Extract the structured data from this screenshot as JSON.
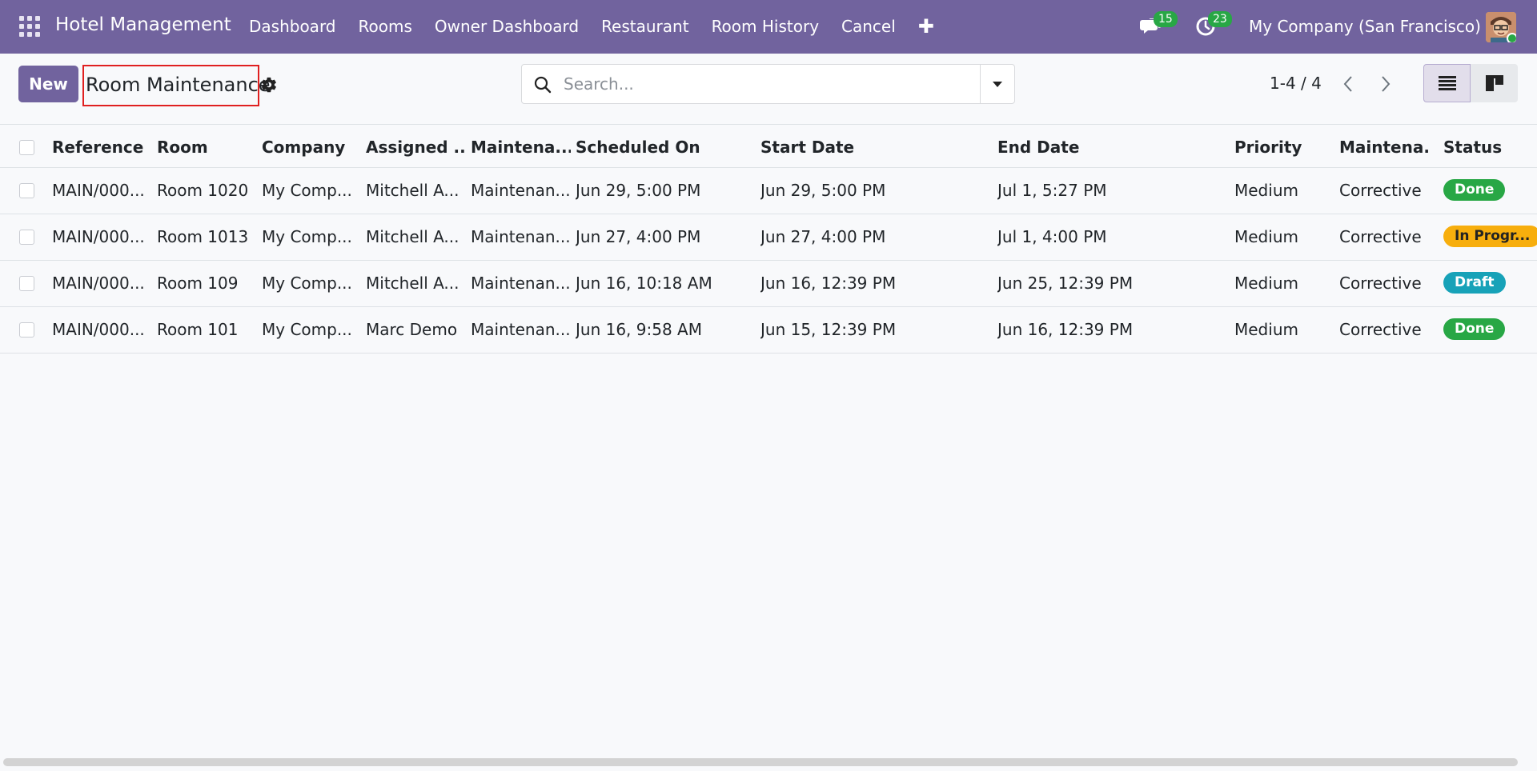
{
  "navbar": {
    "brand": "Hotel Management",
    "menu": [
      "Dashboard",
      "Rooms",
      "Owner Dashboard",
      "Restaurant",
      "Room History",
      "Cancel"
    ],
    "plus": "✚",
    "messages_count": "15",
    "activities_count": "23",
    "company": "My Company (San Francisco)"
  },
  "control": {
    "new_label": "New",
    "title": "Room Maintenance",
    "search_placeholder": "Search...",
    "pager": "1-4 / 4"
  },
  "table": {
    "headers": [
      "Reference",
      "Room",
      "Company",
      "Assigned ...",
      "Maintena...",
      "Scheduled On",
      "Start Date",
      "End Date",
      "Priority",
      "Maintena...",
      "Status"
    ],
    "rows": [
      [
        "MAIN/000...",
        "Room 1020",
        "My Comp...",
        "Mitchell A...",
        "Maintenan...",
        "Jun 29, 5:00 PM",
        "Jun 29, 5:00 PM",
        "Jul 1, 5:27 PM",
        "Medium",
        "Corrective",
        "Done"
      ],
      [
        "MAIN/000...",
        "Room 1013",
        "My Comp...",
        "Mitchell A...",
        "Maintenan...",
        "Jun 27, 4:00 PM",
        "Jun 27, 4:00 PM",
        "Jul 1, 4:00 PM",
        "Medium",
        "Corrective",
        "In Progr..."
      ],
      [
        "MAIN/000...",
        "Room 109",
        "My Comp...",
        "Mitchell A...",
        "Maintenan...",
        "Jun 16, 10:18 AM",
        "Jun 16, 12:39 PM",
        "Jun 25, 12:39 PM",
        "Medium",
        "Corrective",
        "Draft"
      ],
      [
        "MAIN/000...",
        "Room 101",
        "My Comp...",
        "Marc Demo",
        "Maintenan...",
        "Jun 16, 9:58 AM",
        "Jun 15, 12:39 PM",
        "Jun 16, 12:39 PM",
        "Medium",
        "Corrective",
        "Done"
      ]
    ]
  },
  "colors": {
    "brand": "#71639e",
    "done": "#28a745",
    "in_progress": "#f7ae0d",
    "draft": "#17a2b8",
    "highlight": "#e02020"
  }
}
